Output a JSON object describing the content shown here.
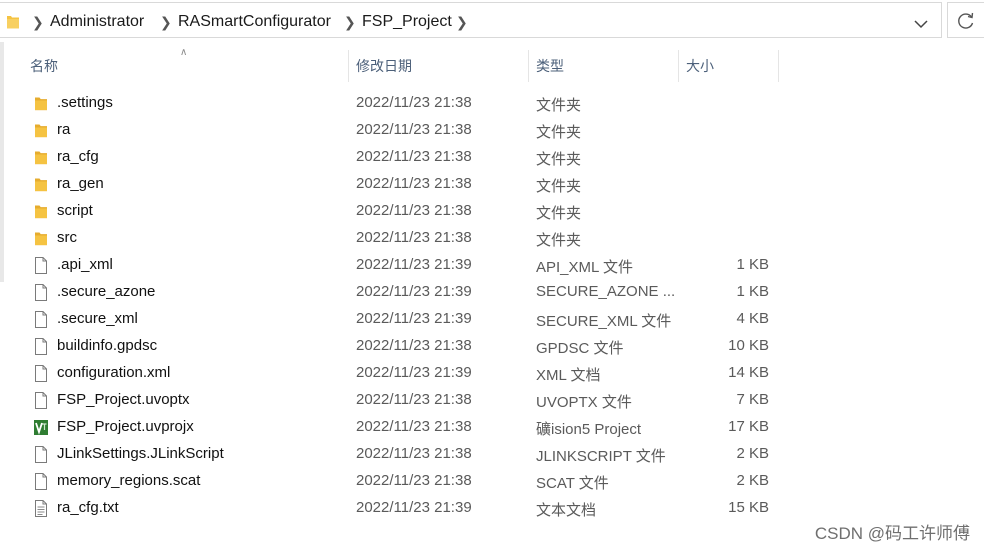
{
  "breadcrumb": {
    "items": [
      "Administrator",
      "RASmartConfigurator",
      "FSP_Project"
    ]
  },
  "columns": {
    "name": "名称",
    "date": "修改日期",
    "type": "类型",
    "size": "大小"
  },
  "files": [
    {
      "name": ".settings",
      "date": "2022/11/23 21:38",
      "type": "文件夹",
      "size": "",
      "icon": "folder-icon"
    },
    {
      "name": "ra",
      "date": "2022/11/23 21:38",
      "type": "文件夹",
      "size": "",
      "icon": "folder-icon"
    },
    {
      "name": "ra_cfg",
      "date": "2022/11/23 21:38",
      "type": "文件夹",
      "size": "",
      "icon": "folder-icon"
    },
    {
      "name": "ra_gen",
      "date": "2022/11/23 21:38",
      "type": "文件夹",
      "size": "",
      "icon": "folder-icon"
    },
    {
      "name": "script",
      "date": "2022/11/23 21:38",
      "type": "文件夹",
      "size": "",
      "icon": "folder-icon"
    },
    {
      "name": "src",
      "date": "2022/11/23 21:38",
      "type": "文件夹",
      "size": "",
      "icon": "folder-icon"
    },
    {
      "name": ".api_xml",
      "date": "2022/11/23 21:39",
      "type": "API_XML 文件",
      "size": "1 KB",
      "icon": "file-icon"
    },
    {
      "name": ".secure_azone",
      "date": "2022/11/23 21:39",
      "type": "SECURE_AZONE ...",
      "size": "1 KB",
      "icon": "file-icon"
    },
    {
      "name": ".secure_xml",
      "date": "2022/11/23 21:39",
      "type": "SECURE_XML 文件",
      "size": "4 KB",
      "icon": "file-icon"
    },
    {
      "name": "buildinfo.gpdsc",
      "date": "2022/11/23 21:38",
      "type": "GPDSC 文件",
      "size": "10 KB",
      "icon": "file-icon"
    },
    {
      "name": "configuration.xml",
      "date": "2022/11/23 21:39",
      "type": "XML 文档",
      "size": "14 KB",
      "icon": "file-icon"
    },
    {
      "name": "FSP_Project.uvoptx",
      "date": "2022/11/23 21:38",
      "type": "UVOPTX 文件",
      "size": "7 KB",
      "icon": "file-icon"
    },
    {
      "name": "FSP_Project.uvprojx",
      "date": "2022/11/23 21:38",
      "type": "礦ision5 Project",
      "size": "17 KB",
      "icon": "uvision-icon"
    },
    {
      "name": "JLinkSettings.JLinkScript",
      "date": "2022/11/23 21:38",
      "type": "JLINKSCRIPT 文件",
      "size": "2 KB",
      "icon": "file-icon"
    },
    {
      "name": "memory_regions.scat",
      "date": "2022/11/23 21:38",
      "type": "SCAT 文件",
      "size": "2 KB",
      "icon": "file-icon"
    },
    {
      "name": "ra_cfg.txt",
      "date": "2022/11/23 21:39",
      "type": "文本文档",
      "size": "15 KB",
      "icon": "text-file-icon"
    }
  ],
  "watermark": "CSDN @码工许师傅",
  "colors": {
    "folder": "#f5c342",
    "uvision": "#2f7d32",
    "header_text": "#4c607a"
  }
}
